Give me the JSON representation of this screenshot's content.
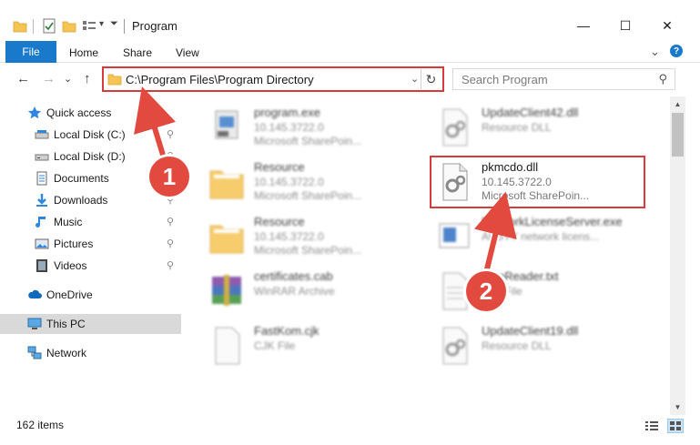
{
  "window": {
    "title": "Program",
    "minimize": "—",
    "maximize": "☐",
    "close": "✕"
  },
  "ribbon": {
    "tabs": [
      "File",
      "Home",
      "Share",
      "View"
    ],
    "expand": "⌄",
    "help": "?"
  },
  "nav": {
    "back": "←",
    "forward": "→",
    "recent": "⌄",
    "up": "↑",
    "address": "C:\\Program Files\\Program Directory",
    "address_dropdown": "⌄",
    "refresh": "↻",
    "search_placeholder": "Search Program",
    "search_icon": "⚲"
  },
  "sidebar": {
    "items": [
      {
        "label": "Quick access",
        "icon": "star-icon",
        "pinned": false
      },
      {
        "label": "Local Disk (C:)",
        "icon": "drive-icon",
        "pinned": true
      },
      {
        "label": "Local Disk (D:)",
        "icon": "drive-icon",
        "pinned": true
      },
      {
        "label": "Documents",
        "icon": "documents-icon",
        "pinned": true
      },
      {
        "label": "Downloads",
        "icon": "download-icon",
        "pinned": true
      },
      {
        "label": "Music",
        "icon": "music-icon",
        "pinned": true
      },
      {
        "label": "Pictures",
        "icon": "pictures-icon",
        "pinned": true
      },
      {
        "label": "Videos",
        "icon": "videos-icon",
        "pinned": true
      },
      {
        "label": "OneDrive",
        "icon": "cloud-icon",
        "pinned": false
      },
      {
        "label": "This PC",
        "icon": "computer-icon",
        "pinned": false,
        "selected": true
      },
      {
        "label": "Network",
        "icon": "network-icon",
        "pinned": false
      }
    ],
    "pin_glyph": "📌"
  },
  "files": [
    {
      "name": "program.exe",
      "line2": "10.145.3722.0",
      "line3": "Microsoft SharePoin...",
      "icon": "exe-icon",
      "blurred": true
    },
    {
      "name": "UpdateClient42.dll",
      "line2": "Resource DLL",
      "line3": "",
      "icon": "dll-icon",
      "blurred": true
    },
    {
      "name": "Resource",
      "line2": "10.145.3722.0",
      "line3": "Microsoft SharePoin...",
      "icon": "folder-icon",
      "blurred": true
    },
    {
      "name": "pkmcdo.dll",
      "line2": "10.145.3722.0",
      "line3": "Microsoft SharePoin...",
      "icon": "dll-icon",
      "blurred": false
    },
    {
      "name": "Resource",
      "line2": "10.145.3722.0",
      "line3": "Microsoft SharePoin...",
      "icon": "folder-icon",
      "blurred": true
    },
    {
      "name": "NetworkLicenseServer.exe",
      "line2": "ABBYY network licens...",
      "line3": "",
      "icon": "exe-icon",
      "blurred": true
    },
    {
      "name": "certificates.cab",
      "line2": "WinRAR Archive",
      "line3": "",
      "icon": "winrar-icon",
      "blurred": true
    },
    {
      "name": "FineReader.txt",
      "line2": "Text File",
      "line3": "",
      "icon": "text-file-icon",
      "blurred": true
    },
    {
      "name": "FastKom.cjk",
      "line2": "CJK File",
      "line3": "",
      "icon": "blank-file-icon",
      "blurred": true
    },
    {
      "name": "UpdateClient19.dll",
      "line2": "Resource DLL",
      "line3": "",
      "icon": "dll-icon",
      "blurred": true
    }
  ],
  "status": {
    "count": "162 items"
  },
  "callouts": [
    "1",
    "2"
  ],
  "colors": {
    "accent": "#1979ca",
    "highlight": "#d83b3b",
    "callout": "#e34a3f",
    "selected": "#d9d9d9",
    "folder": "#f5c453"
  }
}
